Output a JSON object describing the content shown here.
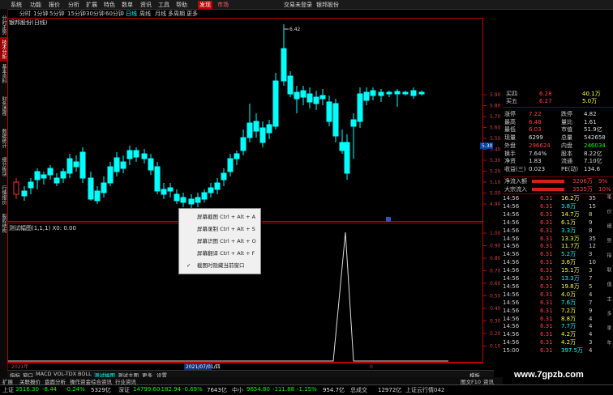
{
  "menu": {
    "items": [
      "系统",
      "功能",
      "报价",
      "分析",
      "扩展",
      "特色",
      "数单",
      "资讯",
      "工具",
      "帮助"
    ],
    "discover": "发现",
    "market": "市场",
    "right_items": [
      "交易未登录",
      "银邦股份"
    ]
  },
  "periods": [
    "分时",
    "1分钟",
    "5分钟",
    "15分钟",
    "30分钟",
    "60分钟",
    "日线",
    "周线",
    "月线",
    "多周期",
    "更多"
  ],
  "left_tabs": [
    "分时走势",
    "技术分析",
    "基本资料",
    "财务透视",
    "数据统计",
    "细分板块",
    "行情报价",
    "股权结构"
  ],
  "main_title": "银邦股份(日线)",
  "peak_label": "6.42",
  "price_ticks": [
    "5.90",
    "5.80",
    "5.70",
    "5.60",
    "5.50",
    "5.40",
    "5.30",
    "5.20",
    "5.10",
    "5.00",
    "4.90"
  ],
  "current_price_tag": "5.30",
  "sub_title": "测试幅图(1,1,1)   X0: 0.00",
  "sub_ticks": [
    "1.00",
    "0.90",
    "0.80",
    "0.70",
    "0.60",
    "0.50",
    "0.40",
    "0.30",
    "0.20",
    "0.10"
  ],
  "context_menu": {
    "items": [
      {
        "label": "屏幕截图 Ctrl + Alt + A",
        "checked": false
      },
      {
        "label": "屏幕录制 Ctrl + Alt + S",
        "checked": false
      },
      {
        "label": "屏幕识图 Ctrl + Alt + O",
        "checked": false
      },
      {
        "label": "屏幕翻译 Ctrl + Alt + F",
        "checked": false
      },
      {
        "label": "截图时隐藏当前窗口",
        "checked": true
      }
    ]
  },
  "quote": {
    "top_rows": [
      {
        "label": "买四",
        "price": "6.28",
        "vol": "40.1万"
      },
      {
        "label": "买五",
        "price": "6.27",
        "vol": "5.0万"
      }
    ],
    "stats": [
      {
        "l1": "涨停",
        "v1": "7.22",
        "l2": "跌停",
        "v2": "4.82"
      },
      {
        "l1": "最高",
        "v1": "6.48",
        "l2": "量比",
        "v2": "1.61"
      },
      {
        "l1": "最低",
        "v1": "6.03",
        "l2": "市值",
        "v2": "51.9亿"
      },
      {
        "l1": "现量",
        "v1": "6299",
        "l2": "总量",
        "v2": "542658"
      },
      {
        "l1": "外盘",
        "v1": "296624",
        "l2": "内盘",
        "v2": "246034"
      },
      {
        "l1": "换手",
        "v1": "7.64%",
        "l2": "股本",
        "v2": "8.22亿"
      },
      {
        "l1": "净资",
        "v1": "1.83",
        "l2": "流通",
        "v2": "7.10亿"
      },
      {
        "l1": "收益(三)",
        "v1": "0.023",
        "l2": "PE(动)",
        "v2": "134.6"
      }
    ],
    "flows": [
      {
        "label": "净流入额",
        "value": "3206万",
        "pct": "9%"
      },
      {
        "label": "大宗流入",
        "value": "3535万",
        "pct": "10%"
      }
    ],
    "ticks": [
      {
        "t": "14:56",
        "p": "6.31",
        "v": "16.2万",
        "n": "35"
      },
      {
        "t": "14:56",
        "p": "6.31",
        "v": "3.8万",
        "n": "15"
      },
      {
        "t": "14:56",
        "p": "6.31",
        "v": "14.7万",
        "n": "8"
      },
      {
        "t": "14:56",
        "p": "6.31",
        "v": "6.1万",
        "n": "9"
      },
      {
        "t": "14:56",
        "p": "6.31",
        "v": "3.3万",
        "n": "8"
      },
      {
        "t": "14:56",
        "p": "6.31",
        "v": "13.3万",
        "n": "35"
      },
      {
        "t": "14:56",
        "p": "6.31",
        "v": "11.7万",
        "n": "12"
      },
      {
        "t": "14:56",
        "p": "6.31",
        "v": "5.2万",
        "n": "3"
      },
      {
        "t": "14:56",
        "p": "6.31",
        "v": "3.6万",
        "n": "10"
      },
      {
        "t": "14:56",
        "p": "6.31",
        "v": "15.1万",
        "n": "3"
      },
      {
        "t": "14:56",
        "p": "6.31",
        "v": "13.3万",
        "n": "7"
      },
      {
        "t": "14:56",
        "p": "6.31",
        "v": "19.8万",
        "n": "5"
      },
      {
        "t": "14:56",
        "p": "6.31",
        "v": "4.0万",
        "n": "4"
      },
      {
        "t": "14:56",
        "p": "6.31",
        "v": "7.6万",
        "n": "7"
      },
      {
        "t": "14:56",
        "p": "6.31",
        "v": "7.2万",
        "n": "9"
      },
      {
        "t": "14:56",
        "p": "6.31",
        "v": "8.8万",
        "n": "4"
      },
      {
        "t": "14:56",
        "p": "6.31",
        "v": "7.7万",
        "n": "4"
      },
      {
        "t": "14:56",
        "p": "6.31",
        "v": "4.2万",
        "n": "4"
      },
      {
        "t": "14:56",
        "p": "6.31",
        "v": "4.2万",
        "n": "3"
      },
      {
        "t": "15:00",
        "p": "6.31",
        "v": "397.5万",
        "n": "4"
      }
    ]
  },
  "right_side_tabs": [
    "笔",
    "价",
    "细",
    "势",
    "指",
    "联",
    "值",
    "主",
    "多",
    "季",
    "年"
  ],
  "left_date": "2021年",
  "cursor_date": "2021/07/01/四",
  "sub_axis_zero": "0",
  "indicator_tabs": [
    "指标",
    "窗口",
    "MACD",
    "VOL-TDX",
    "BOLL",
    "测试幅图",
    "测试主图",
    "更多",
    "设置"
  ],
  "module_tabs": [
    "扩展",
    "关联报价",
    "盘面分析",
    "操作资金",
    "综合资讯",
    "行业资讯"
  ],
  "module_right": [
    "模板",
    "图文F10",
    "资讯"
  ],
  "watermark": "www.7gpzb.com",
  "status": {
    "sh_name": "上证",
    "sh_val": "3516.30",
    "sh_chg": "-8.44",
    "sh_pct": "-0.24%",
    "sh_amt": "5329亿",
    "sz_name": "深证",
    "sz_val": "14799.60",
    "sz_chg": "-182.94",
    "sz_pct": "-0.69%",
    "sz_amt": "7643亿",
    "zx_name": "中小",
    "zx_val": "9654.80",
    "zx_chg": "-111.88",
    "zx_pct": "-1.15%",
    "zx_amt": "954.7亿",
    "total_label": "总成交",
    "total_val": "12972亿",
    "tail": "上证云行情042"
  },
  "colors": {
    "up": "#ff3030",
    "down": "#00ffff",
    "grid": "#7a0000",
    "axis": "#c00000",
    "menu_hl": "#c00000"
  }
}
